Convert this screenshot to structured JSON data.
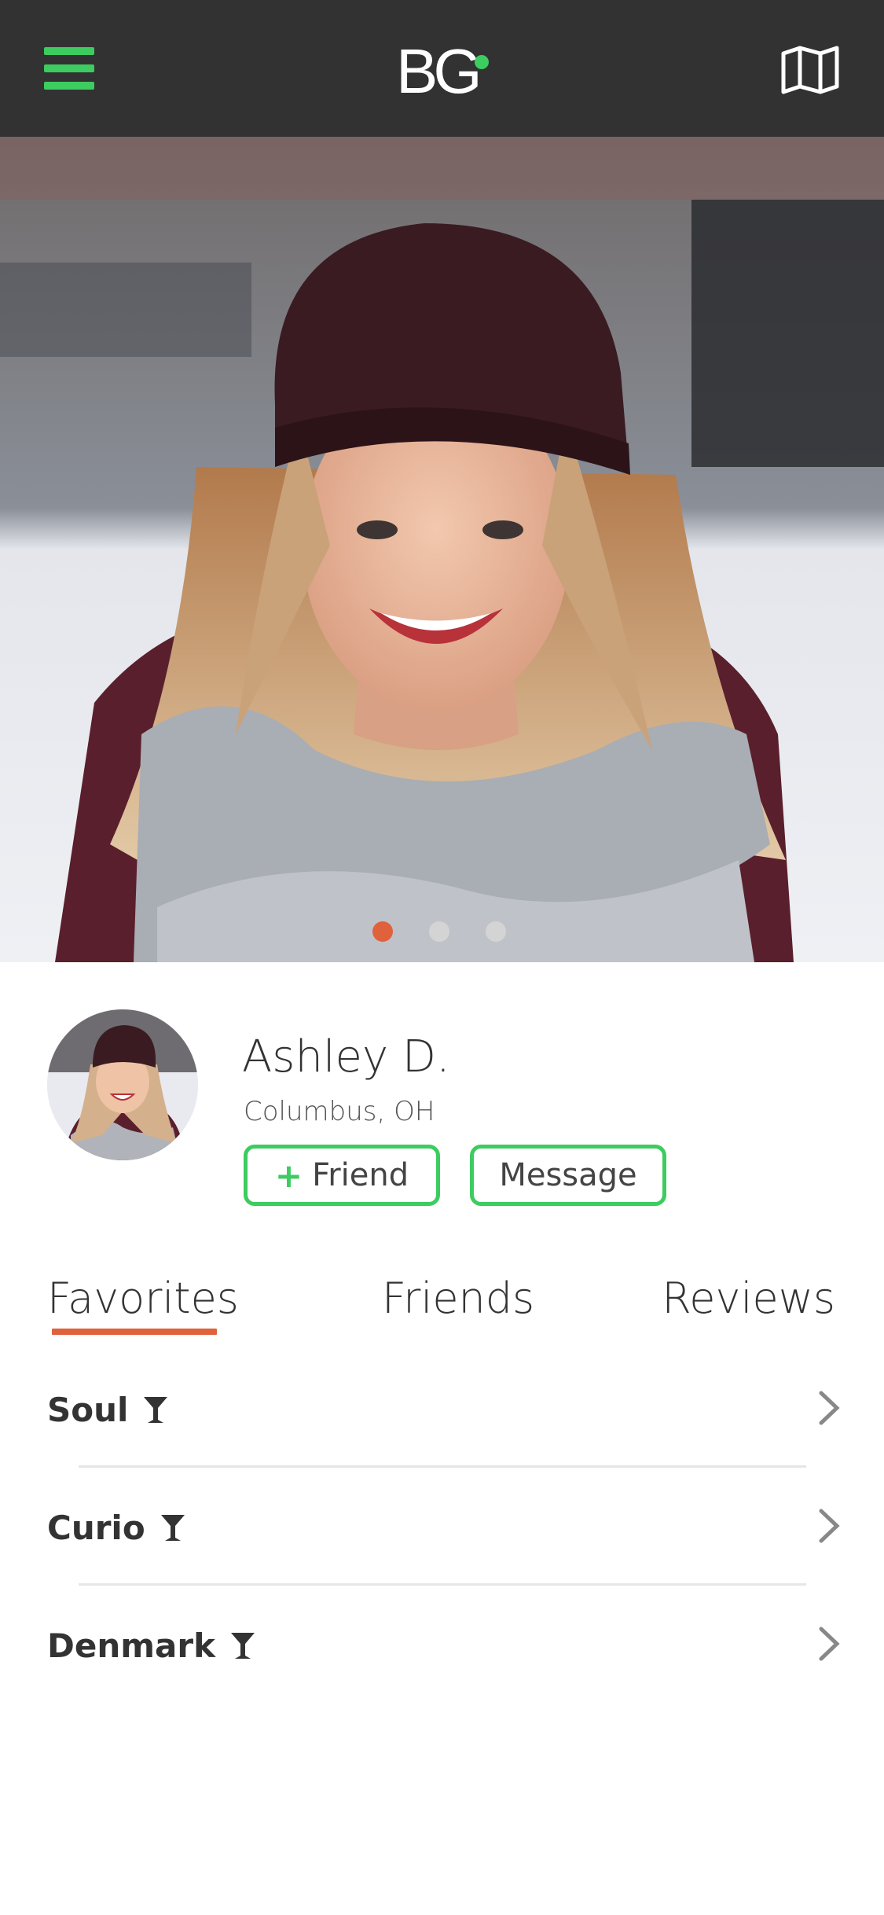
{
  "header": {
    "logo_text": "BG",
    "menu_icon": "hamburger-menu-icon",
    "map_icon": "map-icon",
    "accent_color": "#3ccc5f",
    "background_color": "#323232"
  },
  "hero": {
    "photo": "profile photo of smiling woman in knit beanie and scarf",
    "carousel": {
      "total": 3,
      "active_index": 0
    }
  },
  "profile": {
    "name": "Ashley D.",
    "location": "Columbus, OH",
    "friend_button": {
      "icon": "+",
      "label": "Friend"
    },
    "message_button": {
      "label": "Message"
    }
  },
  "tabs": {
    "active": "Favorites",
    "items": [
      "Favorites",
      "Friends",
      "Reviews"
    ],
    "underline_color": "#e0623c"
  },
  "favorites": [
    {
      "label": "Soul",
      "icon": "cocktail-glass-icon"
    },
    {
      "label": "Curio",
      "icon": "cocktail-glass-icon"
    },
    {
      "label": "Denmark",
      "icon": "cocktail-glass-icon"
    }
  ]
}
